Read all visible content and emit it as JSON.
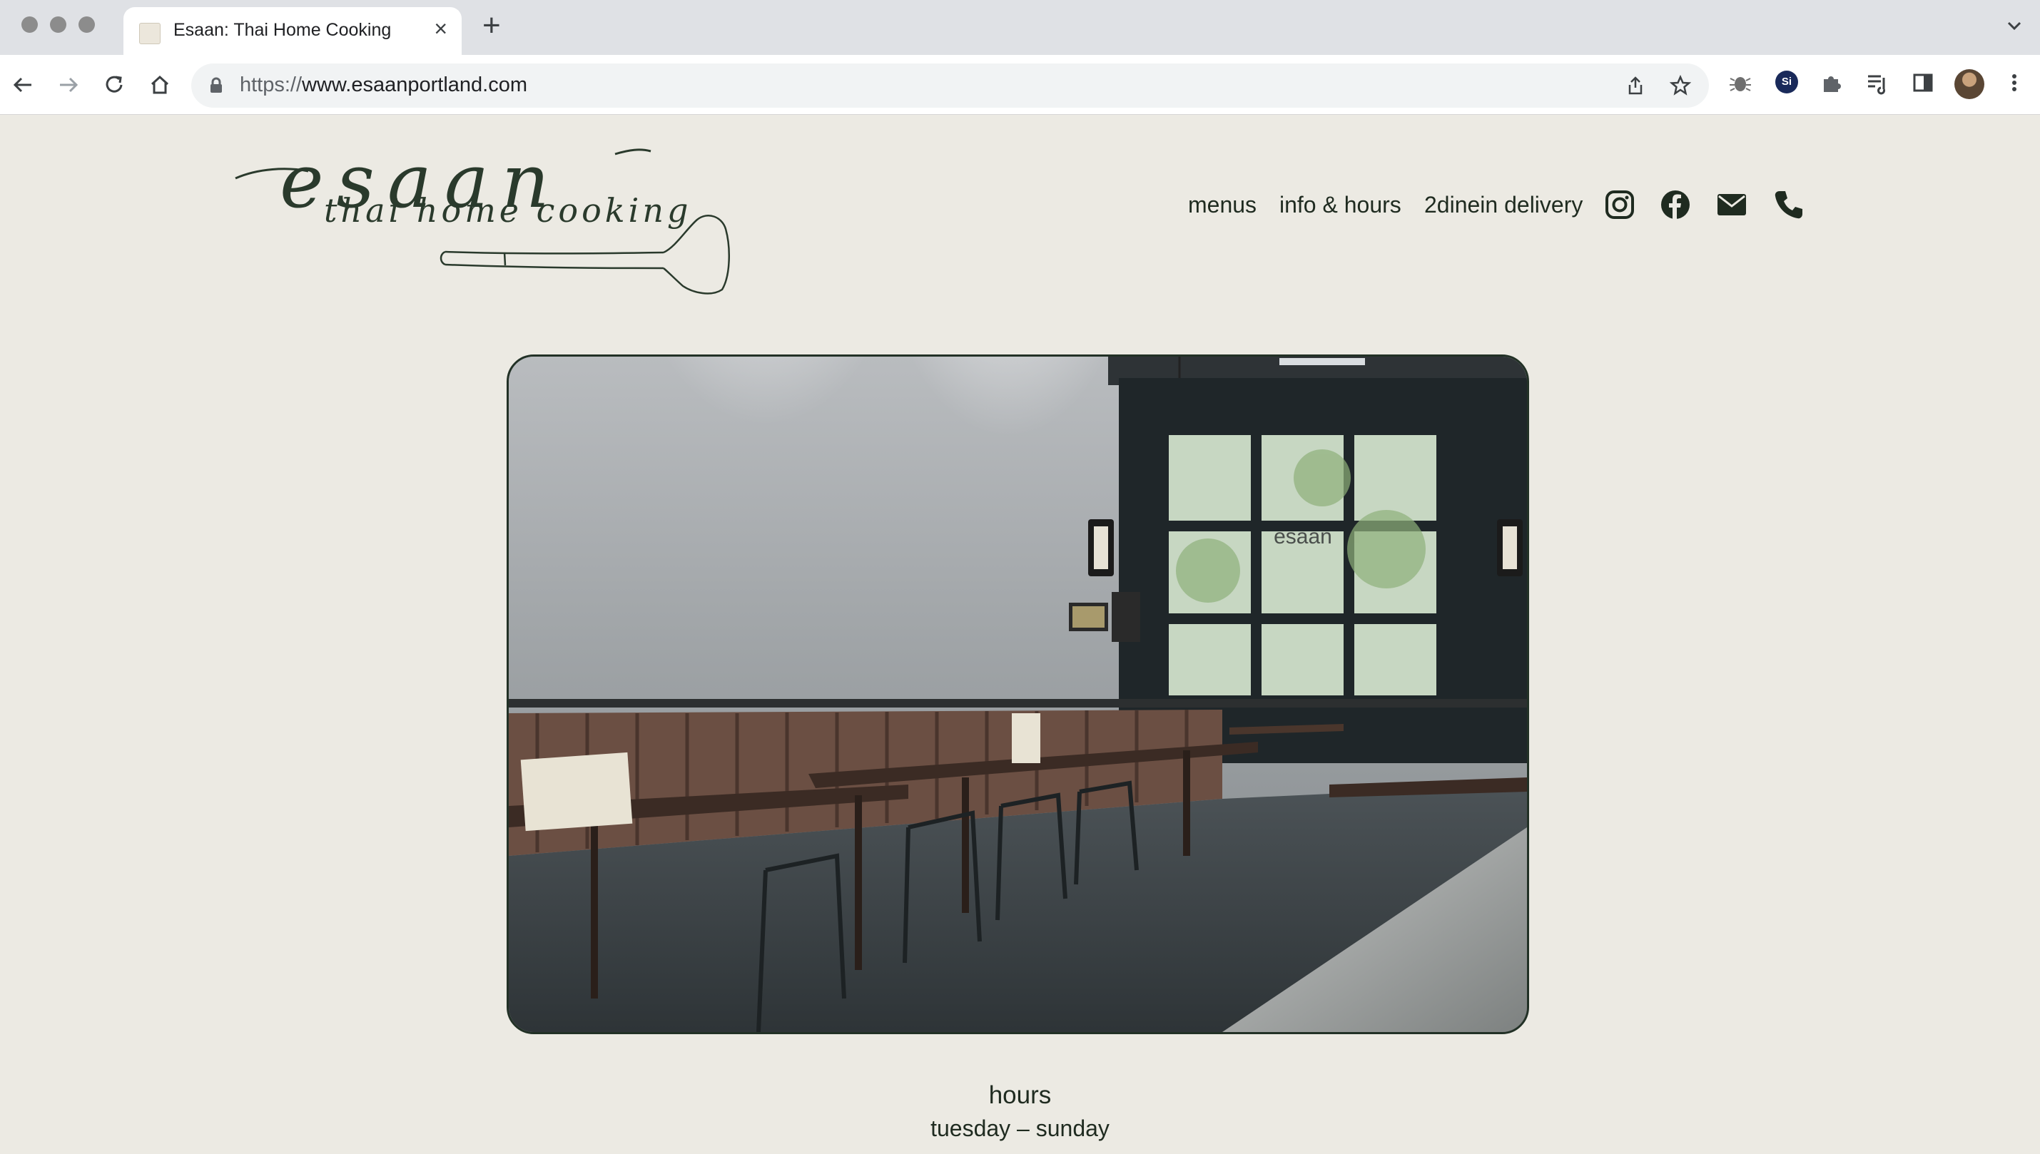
{
  "browser": {
    "tab_title": "Esaan: Thai Home Cooking",
    "url_scheme": "https://",
    "url_host": "www.esaanportland.com"
  },
  "logo": {
    "wordmark": "esaan",
    "tagline": "thai home cooking"
  },
  "nav": {
    "menus": "menus",
    "info_hours": "info & hours",
    "delivery": "2dinein delivery",
    "social_icons": [
      "instagram-icon",
      "facebook-icon",
      "email-icon",
      "phone-icon"
    ]
  },
  "hero": {
    "window_sign": "esaan"
  },
  "hours": {
    "title": "hours",
    "days": "tuesday – sunday"
  },
  "colors": {
    "page_bg": "#eceae3",
    "text": "#1f2b20",
    "hero_border": "#223126"
  }
}
